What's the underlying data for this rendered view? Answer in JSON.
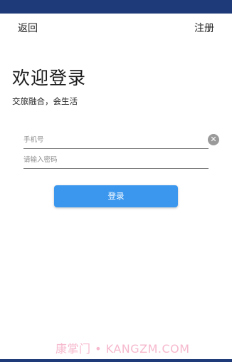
{
  "nav": {
    "back_label": "返回",
    "register_label": "注册"
  },
  "welcome": {
    "title": "欢迎登录",
    "subtitle": "交旅融合，会生活"
  },
  "form": {
    "phone_placeholder": "手机号",
    "phone_value": "",
    "password_placeholder": "请输入密码",
    "password_value": "",
    "clear_icon": "clear-circle-icon",
    "login_label": "登录"
  },
  "watermark": {
    "text": "康掌门 • KANGZM.COM"
  },
  "colors": {
    "status_bar": "#1e3a78",
    "primary_button": "#3b97ee",
    "watermark": "#f6b9cd"
  }
}
